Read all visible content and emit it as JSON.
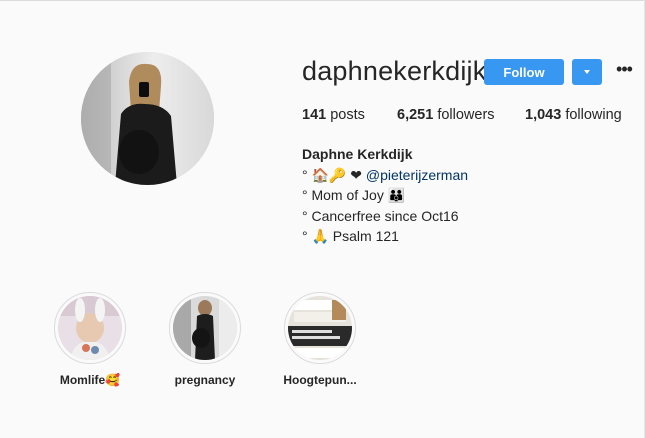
{
  "profile": {
    "username": "daphnekerkdijk",
    "follow_label": "Follow",
    "more_icon": "more-options-icon",
    "stats": {
      "posts": {
        "count": "141",
        "label": "posts"
      },
      "followers": {
        "count": "6,251",
        "label": "followers"
      },
      "following": {
        "count": "1,043",
        "label": "following"
      }
    },
    "bio": {
      "name": "Daphne Kerkdijk",
      "line1_prefix": "° 🏠🔑 ❤ ",
      "line1_mention": "@pieterijzerman",
      "line2": "° Mom of Joy 👪",
      "line3": "° Cancerfree since Oct16",
      "line4": "° 🙏 Psalm 121"
    }
  },
  "highlights": [
    {
      "label": "Momlife🥰"
    },
    {
      "label": "pregnancy"
    },
    {
      "label": "Hoogtepun..."
    }
  ],
  "colors": {
    "accent": "#3897f0",
    "mention": "#003569",
    "background": "#fafafa"
  }
}
